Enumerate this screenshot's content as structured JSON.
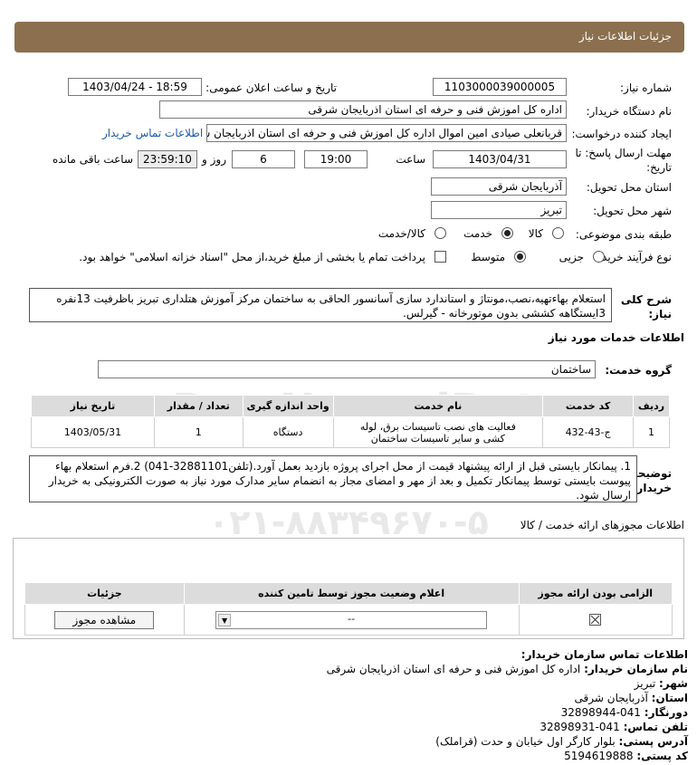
{
  "header": {
    "title": "جزئیات اطلاعات نیاز"
  },
  "form": {
    "need_number_label": "شماره نیاز:",
    "need_number": "1103000039000005",
    "announce_label": "تاریخ و ساعت اعلان عمومی:",
    "announce_value": "1403/04/24 - 18:59",
    "buyer_org_label": "نام دستگاه خریدار:",
    "buyer_org": "اداره کل اموزش فنی و حرفه ای استان اذربایجان شرقی",
    "creator_label": "ایجاد کننده درخواست:",
    "creator": "قربانعلی صیادی امین اموال اداره کل اموزش فنی و حرفه ای استان اذربایجان شر",
    "contact_link": "اطلاعات تماس خریدار",
    "deadline_label_1": "مهلت ارسال پاسخ: تا",
    "deadline_label_2": "تاریخ:",
    "deadline_date": "1403/04/31",
    "time_label": "ساعت",
    "deadline_time": "19:00",
    "days_value": "6",
    "days_label": "روز و",
    "remaining_time": "23:59:10",
    "remaining_label": "ساعت باقی مانده",
    "province_label": "استان محل تحویل:",
    "province": "آذربایجان شرقی",
    "city_label": "شهر محل تحویل:",
    "city": "تبریز",
    "category_label": "طبقه بندی موضوعی:",
    "category_options": [
      "کالا",
      "خدمت",
      "کالا/خدمت"
    ],
    "process_label": "نوع فرآیند خرید :",
    "process_options": [
      "جزیی",
      "متوسط"
    ],
    "treasury_text": "پرداخت تمام یا بخشی از مبلغ خرید،از محل \"اسناد خزانه اسلامی\" خواهد بود."
  },
  "description": {
    "label_1": "شرح کلی",
    "label_2": "نیاز:",
    "text": "استعلام بهاءتهیه،نصب،مونتاژ و استاندارد سازی آسانسور الحاقی به ساختمان مرکز آموزش هتلداری تبریز باظرفیت 13نفره 3ایستگاهه کششی بدون موتورخانه - گیرلس."
  },
  "services": {
    "section_title": "اطلاعات خدمات مورد نیاز",
    "group_label": "گروه خدمت:",
    "group_value": "ساختمان",
    "columns": [
      "ردیف",
      "کد خدمت",
      "نام خدمت",
      "واحد اندازه گیری",
      "تعداد / مقدار",
      "تاریخ نیاز"
    ],
    "rows": [
      {
        "index": "1",
        "code": "ج-43-432",
        "name": "فعالیت های نصب تاسیسات برق، لوله کشی و سایر تاسیسات ساختمان",
        "unit": "دستگاه",
        "qty": "1",
        "date": "1403/05/31"
      }
    ]
  },
  "notes": {
    "label_1": "توضیحات",
    "label_2": "خریدار:",
    "text": "1. پیمانکار بایستی قبل از ارائه پیشنهاد قیمت از محل اجرای پروژه بازدید بعمل آورد.(تلفن32881101-041) 2.فرم استعلام بهاء پیوست بایستی توسط پیمانکار تکمیل و بعد از مهر و امضای مجاز به انضمام سایر مدارک مورد نیاز به صورت الکترونیکی به خریدار ارسال شود."
  },
  "permits": {
    "section_title": "اطلاعات مجوزهای ارائه خدمت / کالا",
    "columns": [
      "الزامی بودن ارائه مجوز",
      "اعلام وضعیت مجوز توسط تامین کننده",
      "جزئیات"
    ],
    "select_value": "--",
    "view_button": "مشاهده مجوز"
  },
  "contact": {
    "title": "اطلاعات تماس سازمان خریدار:",
    "org_label": "نام سازمان خریدار:",
    "org_value": "اداره کل اموزش فنی و حرفه ای استان اذربایجان شرقی",
    "city_label": "شهر:",
    "city_value": "تبریز",
    "province_label": "استان:",
    "province_value": "آذربایجان شرقی",
    "fax_label": "دورنگار:",
    "fax_value": "041-32898944",
    "phone_label": "تلفن تماس:",
    "phone_value": "041-32898931",
    "address_label": "آدرس پستی:",
    "address_value": "بلوار کارگر اول خیابان و حدت (قراملک)",
    "postal_label": "کد پستی:",
    "postal_value": "5194619888"
  },
  "watermark": {
    "text_1": "ParsNamadData",
    "text_2": "۰۲۱-۸۸۳۴۹۶۷۰-۵"
  }
}
